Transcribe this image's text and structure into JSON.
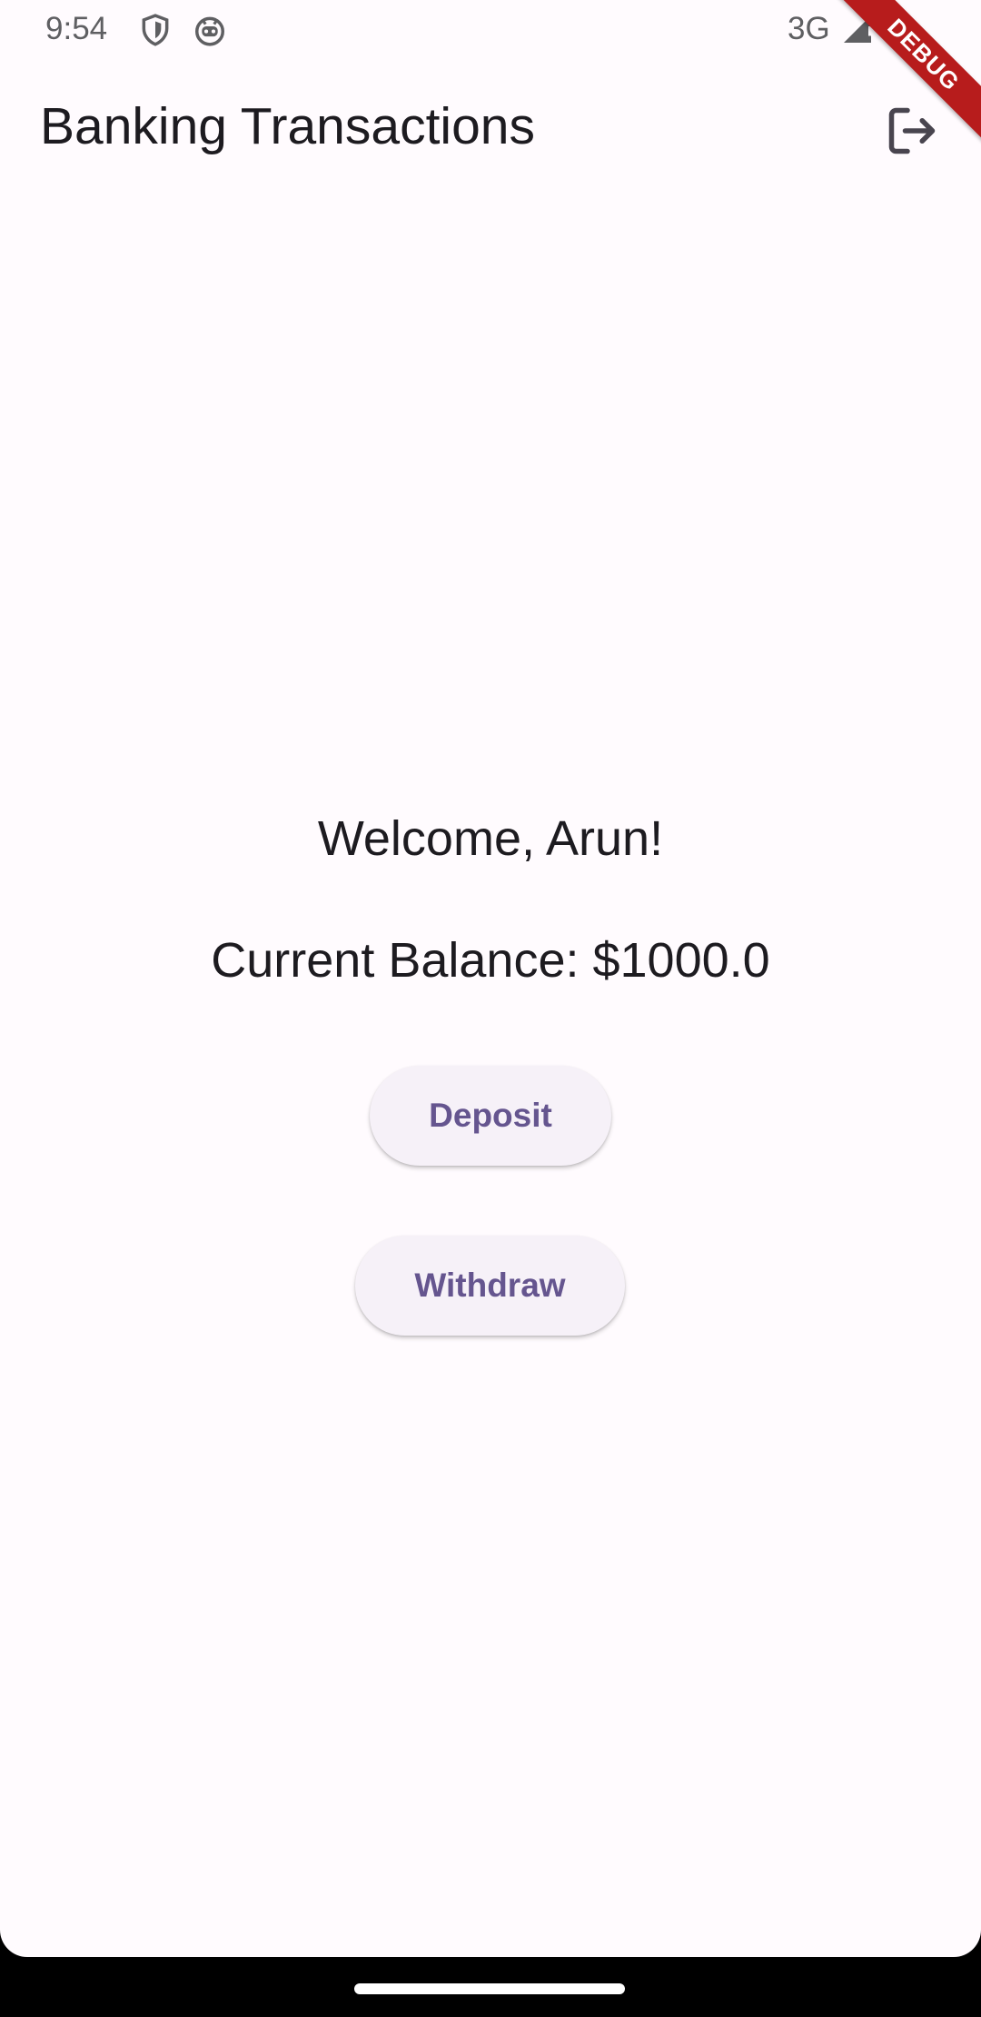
{
  "status_bar": {
    "time": "9:54",
    "network": "3G",
    "icons": [
      "shield-icon",
      "robot-icon",
      "signal-icon",
      "battery-icon"
    ]
  },
  "app_bar": {
    "title": "Banking Transactions",
    "logout_icon": "logout-icon"
  },
  "debug_banner": "DEBUG",
  "content": {
    "welcome": "Welcome, Arun!",
    "balance": "Current Balance: $1000.0",
    "deposit_label": "Deposit",
    "withdraw_label": "Withdraw"
  },
  "colors": {
    "background": "#fffbfe",
    "button_bg": "#f6f1f8",
    "button_text": "#65558f",
    "debug_banner": "#b71c1c"
  }
}
